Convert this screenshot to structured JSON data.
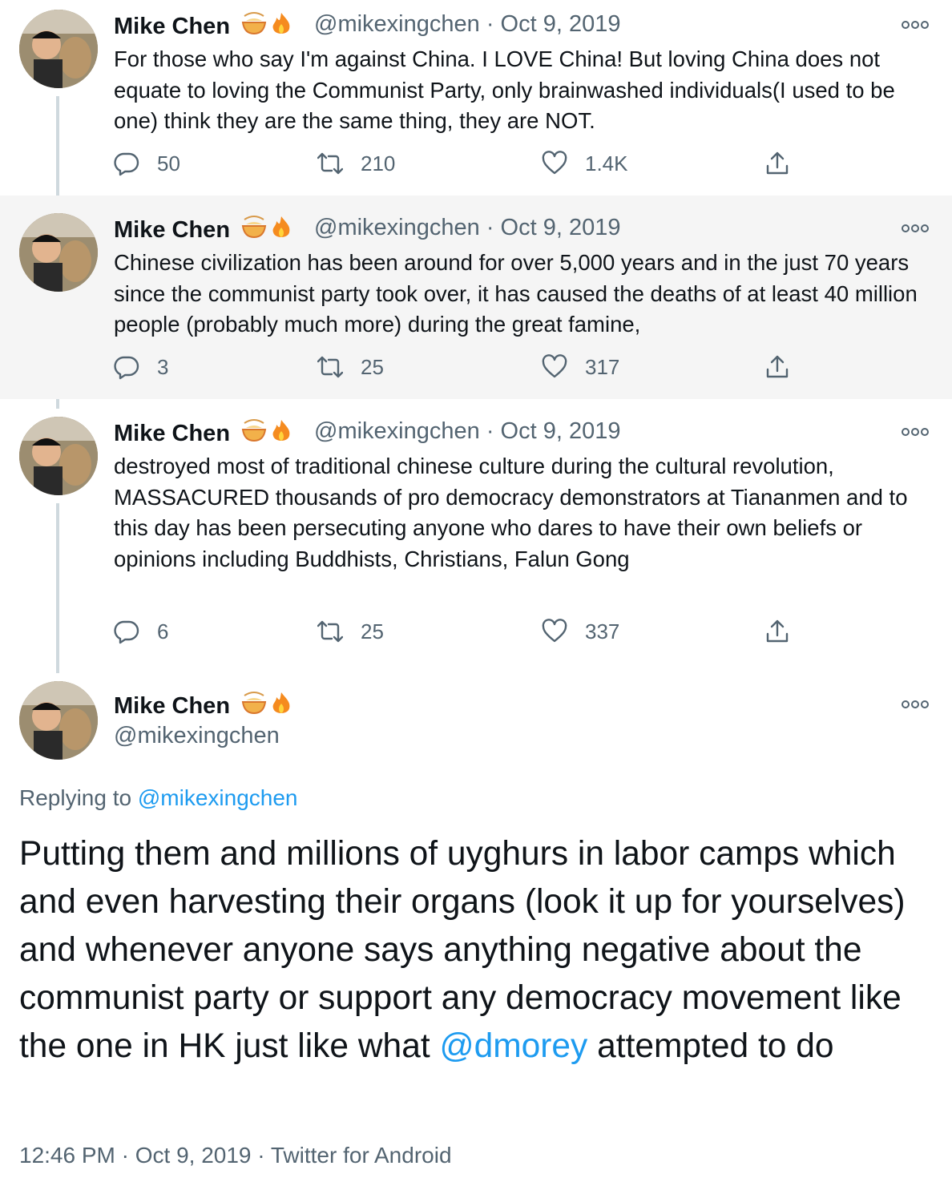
{
  "colors": {
    "text": "#0f1419",
    "muted": "#536471",
    "link": "#1d9bf0",
    "highlight": "#f5f5f5",
    "thread_line": "#cfd9de"
  },
  "author": {
    "name": "Mike Chen",
    "handle": "@mikexingchen",
    "emojis": [
      "noodle-bowl-emoji",
      "fire-emoji"
    ]
  },
  "tweets": [
    {
      "date": "· Oct 9, 2019",
      "text": "For those who say I'm against China. I LOVE China! But loving China does not equate to loving the Communist Party, only brainwashed individuals(I used to be one) think they are the same thing, they are NOT.",
      "replies": "50",
      "retweets": "210",
      "likes": "1.4K"
    },
    {
      "date": "· Oct 9, 2019",
      "text": "Chinese civilization has been around for over 5,000 years and in the just 70 years since the communist party took over, it has caused the deaths of at least 40 million people (probably much more) during the great famine,",
      "replies": "3",
      "retweets": "25",
      "likes": "317"
    },
    {
      "date": "· Oct 9, 2019",
      "text": "destroyed most of traditional chinese culture during the cultural revolution, MASSACURED thousands of pro democracy demonstrators at Tiananmen and to this day has been persecuting anyone who dares to have their own beliefs or opinions including Buddhists, Christians, Falun Gong",
      "replies": "6",
      "retweets": "25",
      "likes": "337"
    }
  ],
  "main": {
    "replying_prefix": "Replying to",
    "replying_handle": "@mikexingchen",
    "text_before_mention": "Putting them and millions of uyghurs in labor camps which and even harvesting their organs (look it up for yourselves) and whenever anyone says anything negative about the communist party or support any democracy movement like the one in HK just like what",
    "mention": "@dmorey",
    "text_after_mention": "attempted to do",
    "timestamp": "12:46 PM · Oct 9, 2019 · Twitter for Android"
  }
}
